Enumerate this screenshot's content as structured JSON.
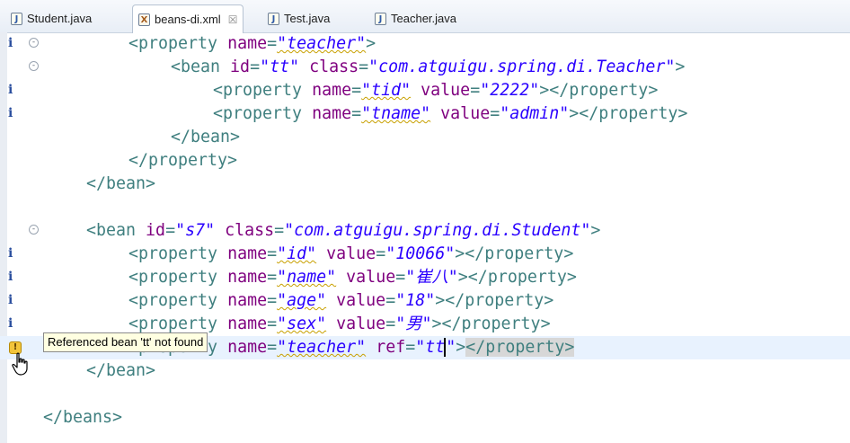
{
  "tabs": [
    {
      "label": "Student.java",
      "icon": "java-file-icon",
      "active": false
    },
    {
      "label": "beans-di.xml",
      "icon": "xml-file-icon",
      "active": true,
      "close": "☒"
    },
    {
      "label": "Test.java",
      "icon": "java-file-icon",
      "active": false
    },
    {
      "label": "Teacher.java",
      "icon": "java-file-icon",
      "active": false
    }
  ],
  "editor": {
    "info_marker": "i",
    "fold_marker": "⊖",
    "lines": [
      {
        "indent": 2,
        "parts": [
          [
            "tg",
            "<property "
          ],
          [
            "at",
            "name"
          ],
          [
            "tg",
            "="
          ],
          [
            "vl",
            "\"teacher\""
          ],
          [
            "tg",
            ">"
          ]
        ]
      },
      {
        "indent": 3,
        "parts": [
          [
            "tg",
            "<bean "
          ],
          [
            "at",
            "id"
          ],
          [
            "tg",
            "="
          ],
          [
            "vl",
            "\"tt\""
          ],
          [
            "tg",
            " "
          ],
          [
            "at",
            "class"
          ],
          [
            "tg",
            "="
          ],
          [
            "vl",
            "\"com.atguigu.spring.di.Teacher\""
          ],
          [
            "tg",
            ">"
          ]
        ]
      },
      {
        "indent": 4,
        "parts": [
          [
            "tg",
            "<property "
          ],
          [
            "at",
            "name"
          ],
          [
            "tg",
            "="
          ],
          [
            "vl",
            "\"tid\""
          ],
          [
            "tg",
            " "
          ],
          [
            "at",
            "value"
          ],
          [
            "tg",
            "="
          ],
          [
            "vl",
            "\"2222\""
          ],
          [
            "tg",
            "></property>"
          ]
        ]
      },
      {
        "indent": 4,
        "parts": [
          [
            "tg",
            "<property "
          ],
          [
            "at",
            "name"
          ],
          [
            "tg",
            "="
          ],
          [
            "vl",
            "\"tname\""
          ],
          [
            "tg",
            " "
          ],
          [
            "at",
            "value"
          ],
          [
            "tg",
            "="
          ],
          [
            "vl",
            "\"admin\""
          ],
          [
            "tg",
            "></property>"
          ]
        ]
      },
      {
        "indent": 3,
        "parts": [
          [
            "tg",
            "</bean>"
          ]
        ]
      },
      {
        "indent": 2,
        "parts": [
          [
            "tg",
            "</property>"
          ]
        ]
      },
      {
        "indent": 1,
        "parts": [
          [
            "tg",
            "</bean>"
          ]
        ]
      },
      {
        "indent": 0,
        "parts": []
      },
      {
        "indent": 1,
        "parts": [
          [
            "tg",
            "<bean "
          ],
          [
            "at",
            "id"
          ],
          [
            "tg",
            "="
          ],
          [
            "vl",
            "\"s7\""
          ],
          [
            "tg",
            " "
          ],
          [
            "at",
            "class"
          ],
          [
            "tg",
            "="
          ],
          [
            "vl",
            "\"com.atguigu.spring.di.Student\""
          ],
          [
            "tg",
            ">"
          ]
        ]
      },
      {
        "indent": 2,
        "parts": [
          [
            "tg",
            "<property "
          ],
          [
            "at",
            "name"
          ],
          [
            "tg",
            "="
          ],
          [
            "vl",
            "\"id\""
          ],
          [
            "tg",
            " "
          ],
          [
            "at",
            "value"
          ],
          [
            "tg",
            "="
          ],
          [
            "vl",
            "\"10066\""
          ],
          [
            "tg",
            "></property>"
          ]
        ]
      },
      {
        "indent": 2,
        "parts": [
          [
            "tg",
            "<property "
          ],
          [
            "at",
            "name"
          ],
          [
            "tg",
            "="
          ],
          [
            "vl",
            "\"name\""
          ],
          [
            "tg",
            " "
          ],
          [
            "at",
            "value"
          ],
          [
            "tg",
            "="
          ],
          [
            "vl",
            "\"崔八\""
          ],
          [
            "tg",
            "></property>"
          ]
        ]
      },
      {
        "indent": 2,
        "parts": [
          [
            "tg",
            "<property "
          ],
          [
            "at",
            "name"
          ],
          [
            "tg",
            "="
          ],
          [
            "vl",
            "\"age\""
          ],
          [
            "tg",
            " "
          ],
          [
            "at",
            "value"
          ],
          [
            "tg",
            "="
          ],
          [
            "vl",
            "\"18\""
          ],
          [
            "tg",
            "></property>"
          ]
        ]
      },
      {
        "indent": 2,
        "parts": [
          [
            "tg",
            "<property "
          ],
          [
            "at",
            "name"
          ],
          [
            "tg",
            "="
          ],
          [
            "vl",
            "\"sex\""
          ],
          [
            "tg",
            " "
          ],
          [
            "at",
            "value"
          ],
          [
            "tg",
            "="
          ],
          [
            "vl",
            "\"男\""
          ],
          [
            "tg",
            "></property>"
          ]
        ]
      },
      {
        "indent": 2,
        "parts": [
          [
            "tg",
            "<property "
          ],
          [
            "at",
            "name"
          ],
          [
            "tg",
            "="
          ],
          [
            "vl",
            "\"teacher\""
          ],
          [
            "tg",
            " "
          ],
          [
            "at",
            "ref"
          ],
          [
            "tg",
            "="
          ],
          [
            "vl",
            "\"tt\""
          ],
          [
            "tg",
            "></property>"
          ]
        ]
      },
      {
        "indent": 1,
        "parts": [
          [
            "tg",
            "</bean>"
          ]
        ]
      },
      {
        "indent": 0,
        "parts": []
      },
      {
        "indent": 0,
        "parts": [
          [
            "tg",
            "</beans>"
          ]
        ]
      }
    ]
  },
  "tooltip": {
    "text": "Referenced bean 'tt' not found"
  },
  "warning_marker": "!"
}
